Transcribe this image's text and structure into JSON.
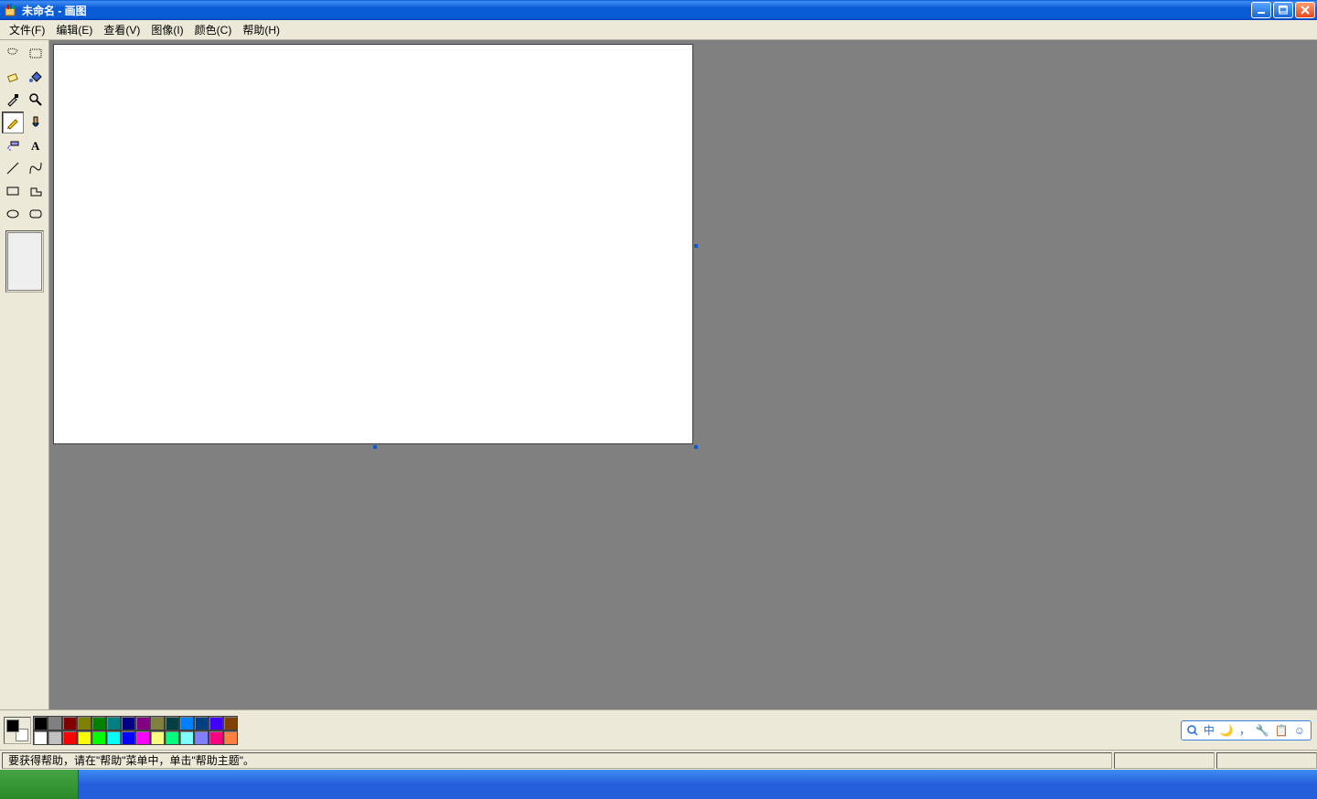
{
  "title": "未命名 - 画图",
  "menus": [
    "文件(F)",
    "编辑(E)",
    "查看(V)",
    "图像(I)",
    "颜色(C)",
    "帮助(H)"
  ],
  "tools": [
    {
      "name": "free-select-tool"
    },
    {
      "name": "rect-select-tool"
    },
    {
      "name": "eraser-tool"
    },
    {
      "name": "fill-tool"
    },
    {
      "name": "eyedropper-tool"
    },
    {
      "name": "magnifier-tool"
    },
    {
      "name": "pencil-tool",
      "selected": true
    },
    {
      "name": "brush-tool"
    },
    {
      "name": "airbrush-tool"
    },
    {
      "name": "text-tool"
    },
    {
      "name": "line-tool"
    },
    {
      "name": "curve-tool"
    },
    {
      "name": "rectangle-tool"
    },
    {
      "name": "polygon-tool"
    },
    {
      "name": "ellipse-tool"
    },
    {
      "name": "rounded-rect-tool"
    }
  ],
  "palette_row1": [
    "#000000",
    "#808080",
    "#800000",
    "#808000",
    "#008000",
    "#008080",
    "#000080",
    "#800080",
    "#808040",
    "#004040",
    "#0080ff",
    "#004080",
    "#4000ff",
    "#804000"
  ],
  "palette_row2": [
    "#ffffff",
    "#c0c0c0",
    "#ff0000",
    "#ffff00",
    "#00ff00",
    "#00ffff",
    "#0000ff",
    "#ff00ff",
    "#ffff80",
    "#00ff80",
    "#80ffff",
    "#8080ff",
    "#ff0080",
    "#ff8040"
  ],
  "current_fg": "#000000",
  "current_bg": "#ffffff",
  "status_text": "要获得帮助，请在\"帮助\"菜单中，单击\"帮助主题\"。",
  "ime_items": [
    "中",
    "🌙",
    "，",
    "🔧",
    "📋",
    "☺"
  ]
}
